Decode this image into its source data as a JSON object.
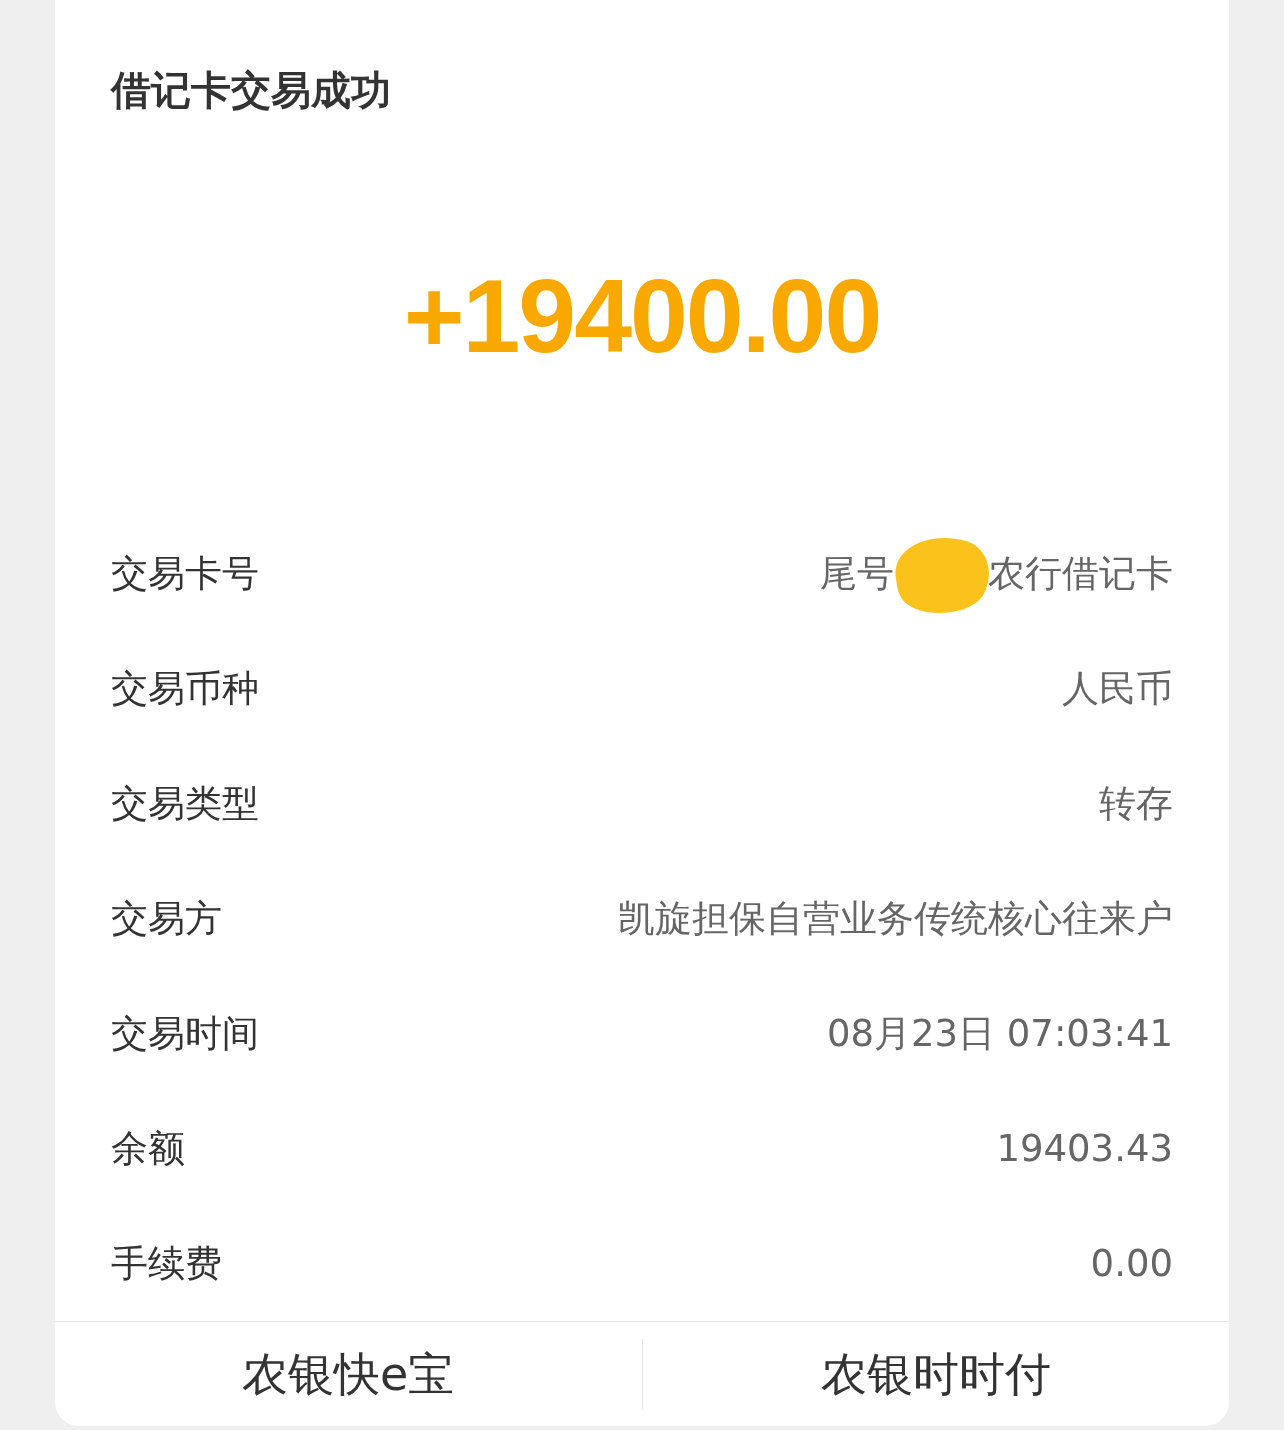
{
  "card": {
    "title": "借记卡交易成功",
    "amount": "+19400.00",
    "rows": [
      {
        "label": "交易卡号",
        "kind": "redacted",
        "value_before": "尾号",
        "value_after": "农行借记卡"
      },
      {
        "label": "交易币种",
        "kind": "text",
        "value": "人民币"
      },
      {
        "label": "交易类型",
        "kind": "text",
        "value": "转存"
      },
      {
        "label": "交易方",
        "kind": "text",
        "value": "凯旋担保自营业务传统核心往来户"
      },
      {
        "label": "交易时间",
        "kind": "text",
        "value": "08月23日 07:03:41"
      },
      {
        "label": "余额",
        "kind": "text",
        "value": "19403.43"
      },
      {
        "label": "手续费",
        "kind": "text",
        "value": "0.00"
      }
    ],
    "actions": [
      "农银快e宝",
      "农银时时付"
    ]
  }
}
